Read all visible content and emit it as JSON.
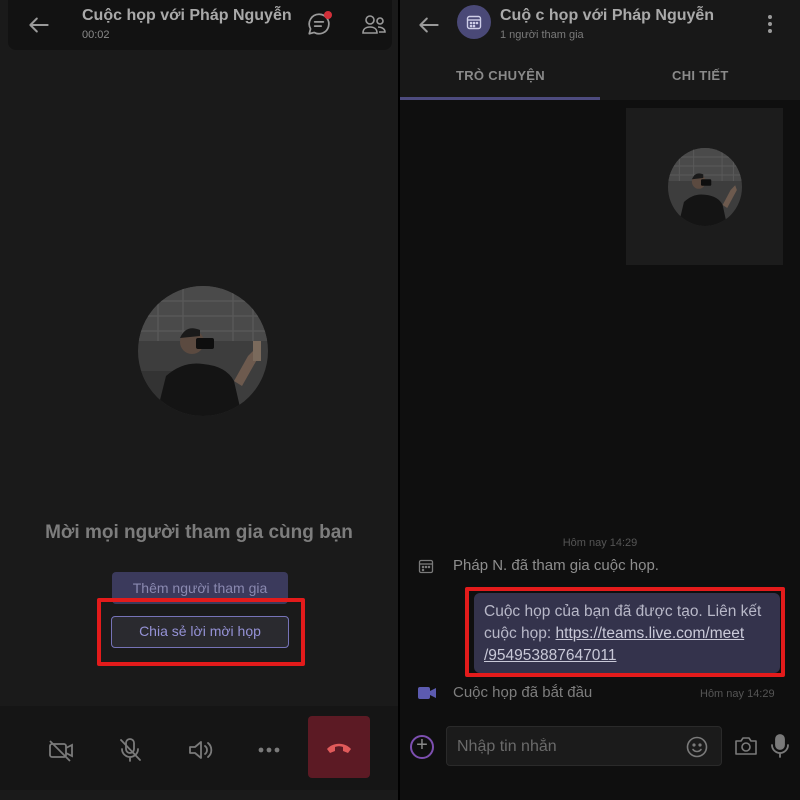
{
  "call": {
    "title": "Cuộc họp với Pháp Nguyễn",
    "timer": "00:02",
    "invite_heading": "Mời mọi người tham gia cùng bạn",
    "add_participants_label": "Thêm người tham gia",
    "share_invite_label": "Chia sẻ lời mời họp",
    "controls": [
      "video-off-icon",
      "mic-off-icon",
      "speaker-icon",
      "more-icon",
      "hang-up-icon"
    ],
    "has_unread_chat": true
  },
  "chat": {
    "title": "Cuộ c họp với Pháp Nguyễn",
    "subtitle": "1 người tham gia",
    "tabs": [
      {
        "label": "TRÒ CHUYỆN",
        "active": true
      },
      {
        "label": "CHI TIẾT",
        "active": false
      }
    ],
    "timestamp": "Hôm nay 14:29",
    "system_message": "Pháp N. đã tham gia cuộc họp.",
    "bubble": {
      "text_line1": "Cuộc họp của bạn đã được tạo. Liên kết",
      "text_prefix": "cuộc họp: ",
      "link_line1": "https://teams.live.com/meet",
      "link_line2": "/954953887647011"
    },
    "meeting_started": {
      "text": "Cuộc họp đã bắt đầu",
      "time": "Hôm nay 14:29"
    },
    "compose_placeholder": "Nhập tin nhắn"
  },
  "colors": {
    "accent": "#7673b7",
    "highlight": "#e31b1b",
    "hangup": "#5c1a24",
    "bubble": "#34334c"
  }
}
